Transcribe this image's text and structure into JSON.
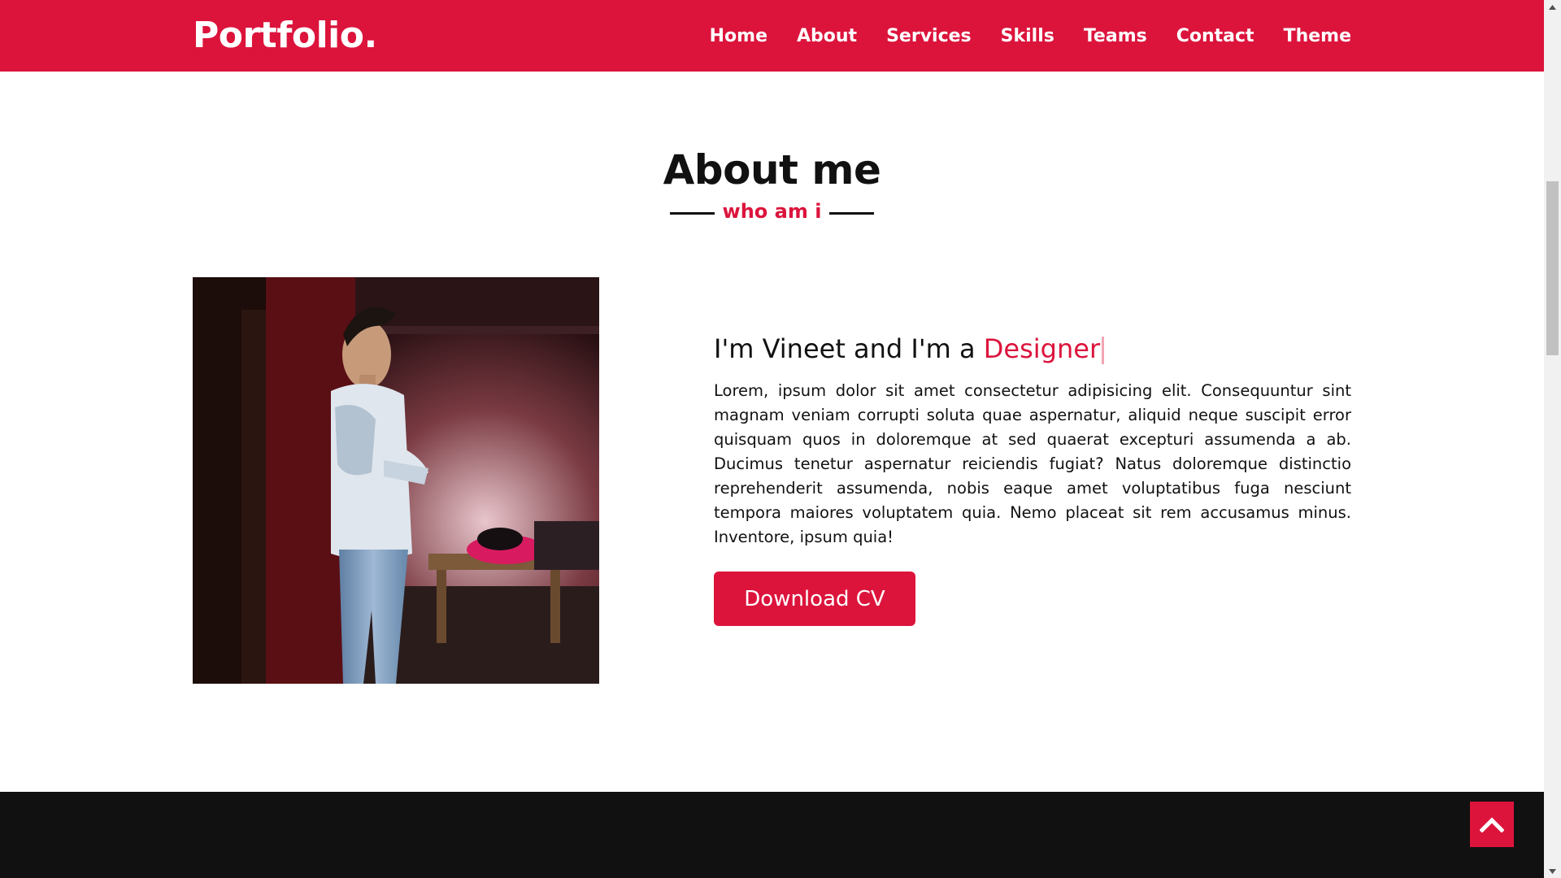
{
  "navbar": {
    "logo": "Portfolio.",
    "items": [
      {
        "label": "Home"
      },
      {
        "label": "About"
      },
      {
        "label": "Services"
      },
      {
        "label": "Skills"
      },
      {
        "label": "Teams"
      },
      {
        "label": "Contact"
      },
      {
        "label": "Theme"
      }
    ]
  },
  "about": {
    "title": "About me",
    "subtitle": "who am i",
    "heading_prefix": "I'm Vineet and I'm a ",
    "heading_role": "Designer",
    "body": "Lorem, ipsum dolor sit amet consectetur adipisicing elit. Consequuntur sint magnam veniam corrupti soluta quae aspernatur, aliquid neque suscipit error quisquam quos in doloremque at sed quaerat excepturi assumenda a ab. Ducimus tenetur aspernatur reiciendis fugiat? Natus doloremque distinctio reprehenderit assumenda, nobis eaque amet voluptatibus fuga nesciunt tempora maiores voluptatem quia. Nemo placeat sit rem accusamus minus. Inventore, ipsum quia!",
    "button_label": "Download CV"
  },
  "colors": {
    "accent": "#dc143c",
    "dark": "#111111"
  },
  "icons": {
    "scroll_top": "chevron-up-icon"
  }
}
